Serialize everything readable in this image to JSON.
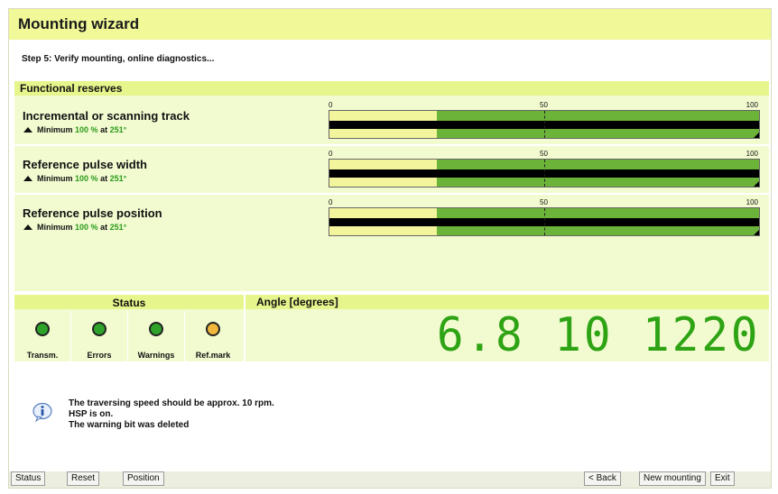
{
  "window": {
    "title": "Mounting wizard"
  },
  "step_text": "Step 5: Verify mounting, online diagnostics...",
  "functional_reserves": {
    "heading": "Functional reserves",
    "scale": {
      "min": "0",
      "mid": "50",
      "max": "100"
    },
    "rows": [
      {
        "label": "Incremental or scanning track",
        "min_prefix": "Minimum",
        "min_value": "100 %",
        "min_at": "at",
        "min_angle": "251°",
        "yellow_fraction": 0.25
      },
      {
        "label": "Reference pulse width",
        "min_prefix": "Minimum",
        "min_value": "100 %",
        "min_at": "at",
        "min_angle": "251°",
        "yellow_fraction": 0.25
      },
      {
        "label": "Reference pulse position",
        "min_prefix": "Minimum",
        "min_value": "100 %",
        "min_at": "at",
        "min_angle": "251°",
        "yellow_fraction": 0.25
      }
    ]
  },
  "status": {
    "heading": "Status",
    "leds": [
      {
        "label": "Transm.",
        "color": "#2fa22a"
      },
      {
        "label": "Errors",
        "color": "#2fa22a"
      },
      {
        "label": "Warnings",
        "color": "#2fa22a"
      },
      {
        "label": "Ref.mark",
        "color": "#f0b63e"
      }
    ]
  },
  "angle": {
    "heading": "Angle [degrees]",
    "value": "6.8 10 1220"
  },
  "messages": {
    "icon": "info-icon",
    "lines": [
      "The traversing speed should be approx. 10 rpm.",
      "HSP is on.",
      "The warning bit was deleted"
    ]
  },
  "footer": {
    "status": "Status",
    "reset": "Reset",
    "position": "Position",
    "back": "< Back",
    "new_mounting": "New mounting",
    "exit": "Exit"
  },
  "colors": {
    "title_bg": "#f0f898",
    "panel_bg": "#f2fbd0",
    "head_bg": "#e6f58c",
    "gauge_green": "#6cb33a",
    "gauge_yellow": "#f2f59c",
    "display_green": "#2ea314"
  }
}
